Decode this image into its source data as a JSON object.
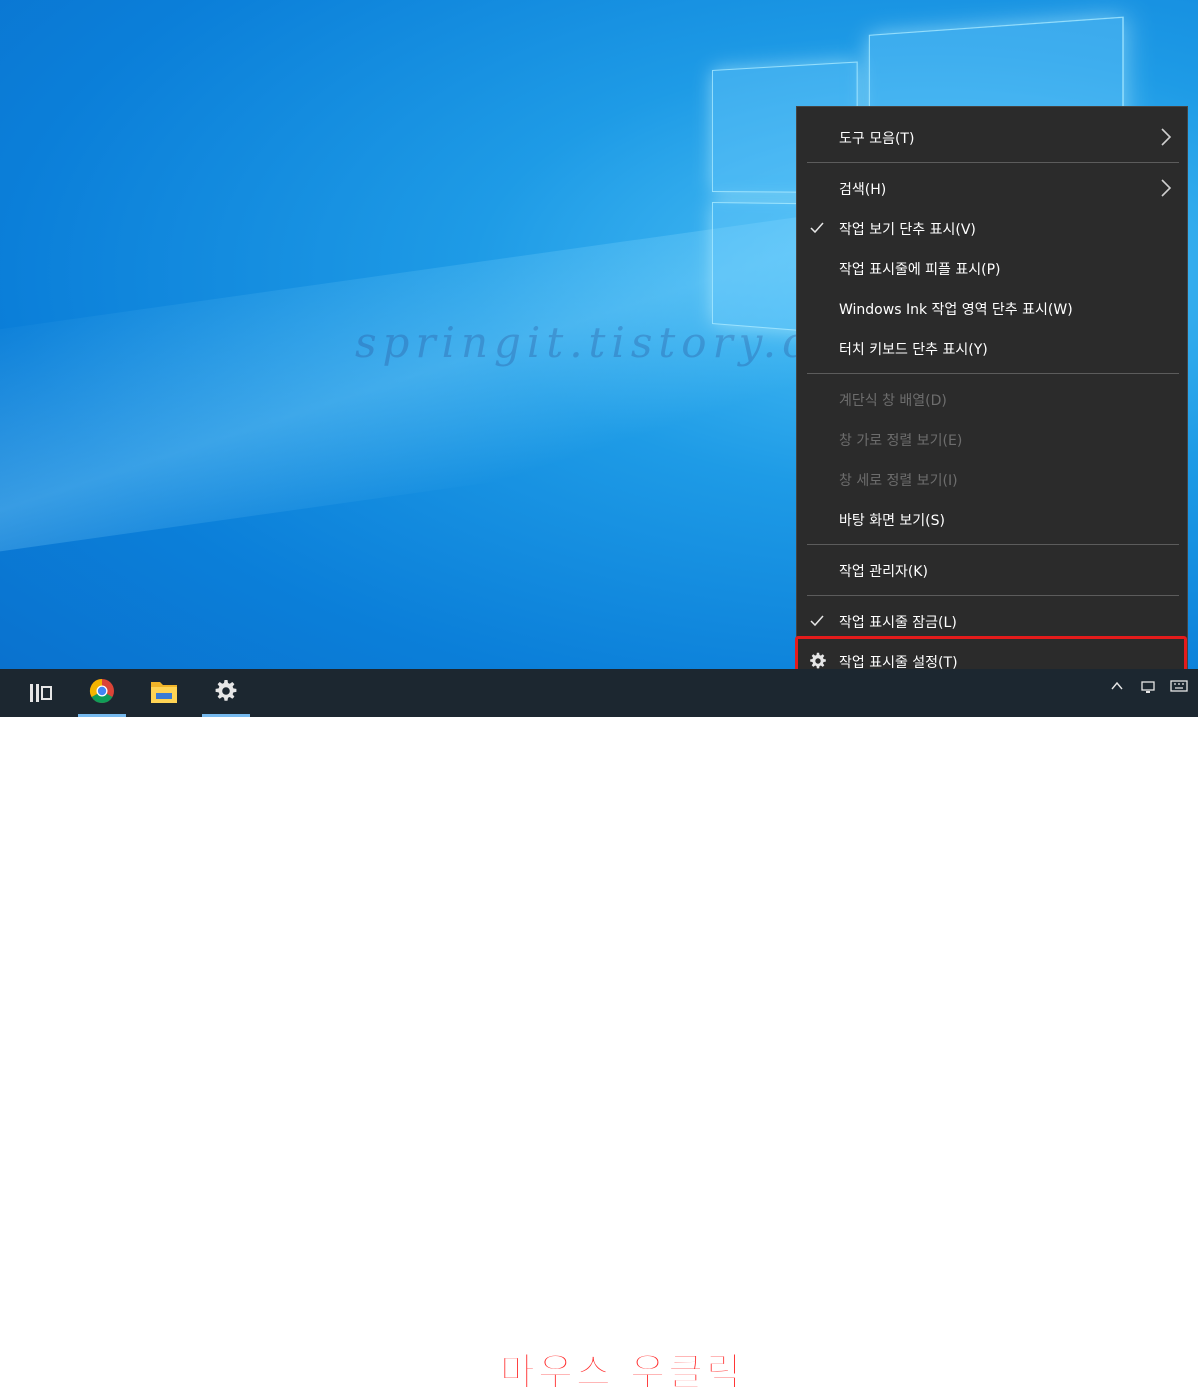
{
  "watermark": "springit.tistory.c",
  "context_menu": {
    "items": [
      {
        "label": "도구 모음(T)"
      },
      {
        "label": "검색(H)"
      },
      {
        "label": "작업 보기 단추 표시(V)"
      },
      {
        "label": "작업 표시줄에 피플 표시(P)"
      },
      {
        "label": "Windows Ink 작업 영역 단추 표시(W)"
      },
      {
        "label": "터치 키보드 단추 표시(Y)"
      },
      {
        "label": "계단식 창 배열(D)"
      },
      {
        "label": "창 가로 정렬 보기(E)"
      },
      {
        "label": "창 세로 정렬 보기(I)"
      },
      {
        "label": "바탕 화면 보기(S)"
      },
      {
        "label": "작업 관리자(K)"
      },
      {
        "label": "작업 표시줄 잠금(L)"
      },
      {
        "label": "작업 표시줄 설정(T)"
      }
    ]
  },
  "callout": "마우스 우클릭",
  "colors": {
    "highlight": "#e41b1b",
    "menu_bg": "#2b2b2b",
    "taskbar_bg": "#1c2730",
    "accent": "#76b9ed"
  }
}
